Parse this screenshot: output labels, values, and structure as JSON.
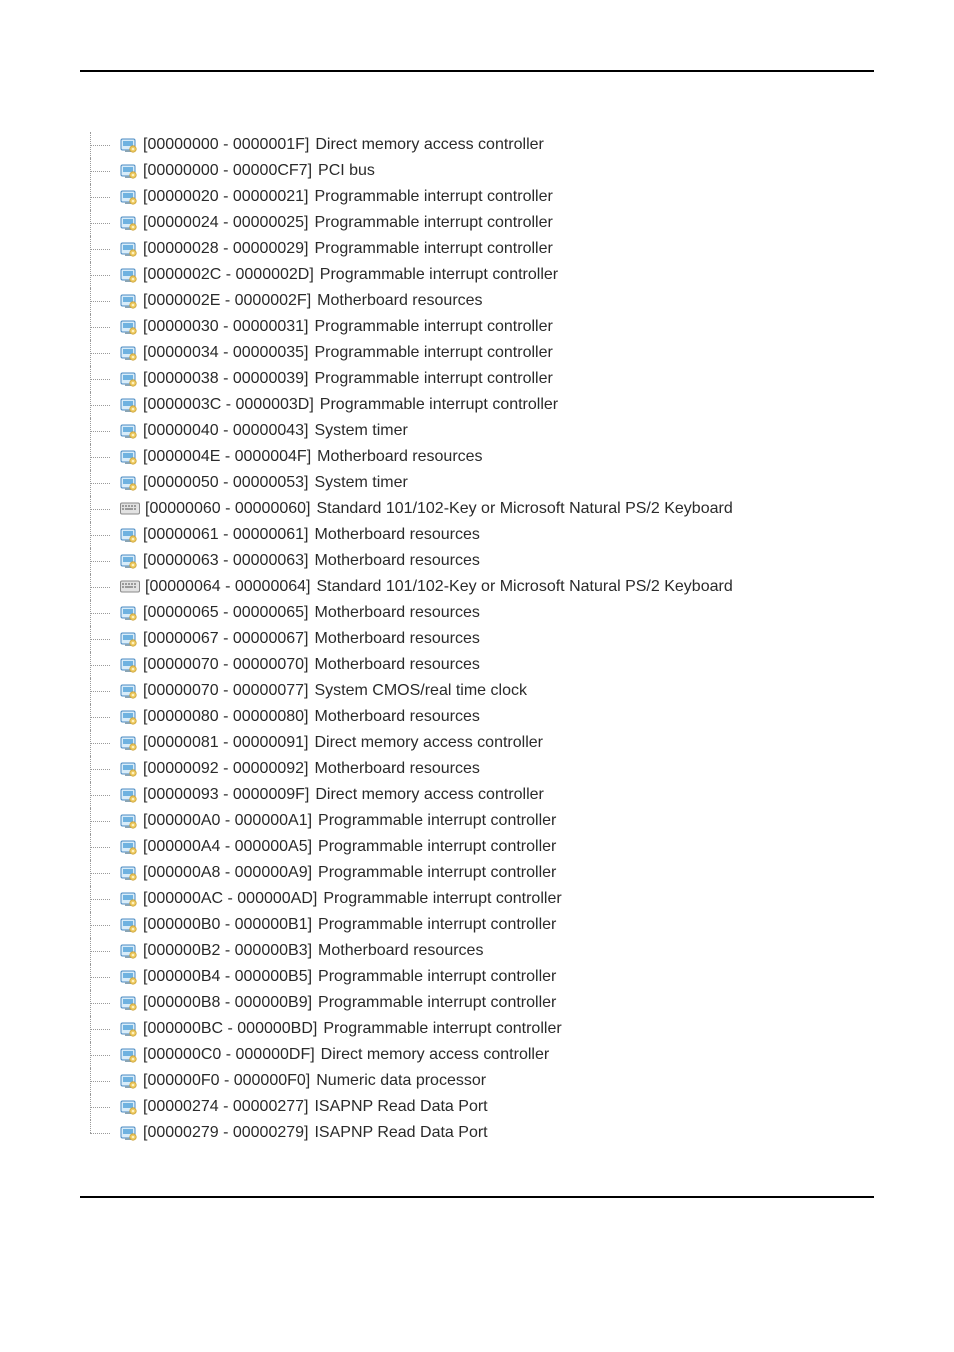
{
  "items": [
    {
      "range": "[00000000 - 0000001F]",
      "label": "Direct memory access controller",
      "icon": "device"
    },
    {
      "range": "[00000000 - 00000CF7]",
      "label": "PCI bus",
      "icon": "device"
    },
    {
      "range": "[00000020 - 00000021]",
      "label": "Programmable interrupt controller",
      "icon": "device"
    },
    {
      "range": "[00000024 - 00000025]",
      "label": "Programmable interrupt controller",
      "icon": "device"
    },
    {
      "range": "[00000028 - 00000029]",
      "label": "Programmable interrupt controller",
      "icon": "device"
    },
    {
      "range": "[0000002C - 0000002D]",
      "label": "Programmable interrupt controller",
      "icon": "device"
    },
    {
      "range": "[0000002E - 0000002F]",
      "label": "Motherboard resources",
      "icon": "device"
    },
    {
      "range": "[00000030 - 00000031]",
      "label": "Programmable interrupt controller",
      "icon": "device"
    },
    {
      "range": "[00000034 - 00000035]",
      "label": "Programmable interrupt controller",
      "icon": "device"
    },
    {
      "range": "[00000038 - 00000039]",
      "label": "Programmable interrupt controller",
      "icon": "device"
    },
    {
      "range": "[0000003C - 0000003D]",
      "label": "Programmable interrupt controller",
      "icon": "device"
    },
    {
      "range": "[00000040 - 00000043]",
      "label": "System timer",
      "icon": "device"
    },
    {
      "range": "[0000004E - 0000004F]",
      "label": "Motherboard resources",
      "icon": "device"
    },
    {
      "range": "[00000050 - 00000053]",
      "label": "System timer",
      "icon": "device"
    },
    {
      "range": "[00000060 - 00000060]",
      "label": "Standard 101/102-Key or Microsoft Natural PS/2 Keyboard",
      "icon": "keyboard"
    },
    {
      "range": "[00000061 - 00000061]",
      "label": "Motherboard resources",
      "icon": "device"
    },
    {
      "range": "[00000063 - 00000063]",
      "label": "Motherboard resources",
      "icon": "device"
    },
    {
      "range": "[00000064 - 00000064]",
      "label": "Standard 101/102-Key or Microsoft Natural PS/2 Keyboard",
      "icon": "keyboard"
    },
    {
      "range": "[00000065 - 00000065]",
      "label": "Motherboard resources",
      "icon": "device"
    },
    {
      "range": "[00000067 - 00000067]",
      "label": "Motherboard resources",
      "icon": "device"
    },
    {
      "range": "[00000070 - 00000070]",
      "label": "Motherboard resources",
      "icon": "device"
    },
    {
      "range": "[00000070 - 00000077]",
      "label": "System CMOS/real time clock",
      "icon": "device"
    },
    {
      "range": "[00000080 - 00000080]",
      "label": "Motherboard resources",
      "icon": "device"
    },
    {
      "range": "[00000081 - 00000091]",
      "label": "Direct memory access controller",
      "icon": "device"
    },
    {
      "range": "[00000092 - 00000092]",
      "label": "Motherboard resources",
      "icon": "device"
    },
    {
      "range": "[00000093 - 0000009F]",
      "label": "Direct memory access controller",
      "icon": "device"
    },
    {
      "range": "[000000A0 - 000000A1]",
      "label": "Programmable interrupt controller",
      "icon": "device"
    },
    {
      "range": "[000000A4 - 000000A5]",
      "label": "Programmable interrupt controller",
      "icon": "device"
    },
    {
      "range": "[000000A8 - 000000A9]",
      "label": "Programmable interrupt controller",
      "icon": "device"
    },
    {
      "range": "[000000AC - 000000AD]",
      "label": "Programmable interrupt controller",
      "icon": "device"
    },
    {
      "range": "[000000B0 - 000000B1]",
      "label": "Programmable interrupt controller",
      "icon": "device"
    },
    {
      "range": "[000000B2 - 000000B3]",
      "label": "Motherboard resources",
      "icon": "device"
    },
    {
      "range": "[000000B4 - 000000B5]",
      "label": "Programmable interrupt controller",
      "icon": "device"
    },
    {
      "range": "[000000B8 - 000000B9]",
      "label": "Programmable interrupt controller",
      "icon": "device"
    },
    {
      "range": "[000000BC - 000000BD]",
      "label": "Programmable interrupt controller",
      "icon": "device"
    },
    {
      "range": "[000000C0 - 000000DF]",
      "label": "Direct memory access controller",
      "icon": "device"
    },
    {
      "range": "[000000F0 - 000000F0]",
      "label": "Numeric data processor",
      "icon": "device"
    },
    {
      "range": "[00000274 - 00000277]",
      "label": "ISAPNP Read Data Port",
      "icon": "device"
    },
    {
      "range": "[00000279 - 00000279]",
      "label": "ISAPNP Read Data Port",
      "icon": "device"
    }
  ]
}
